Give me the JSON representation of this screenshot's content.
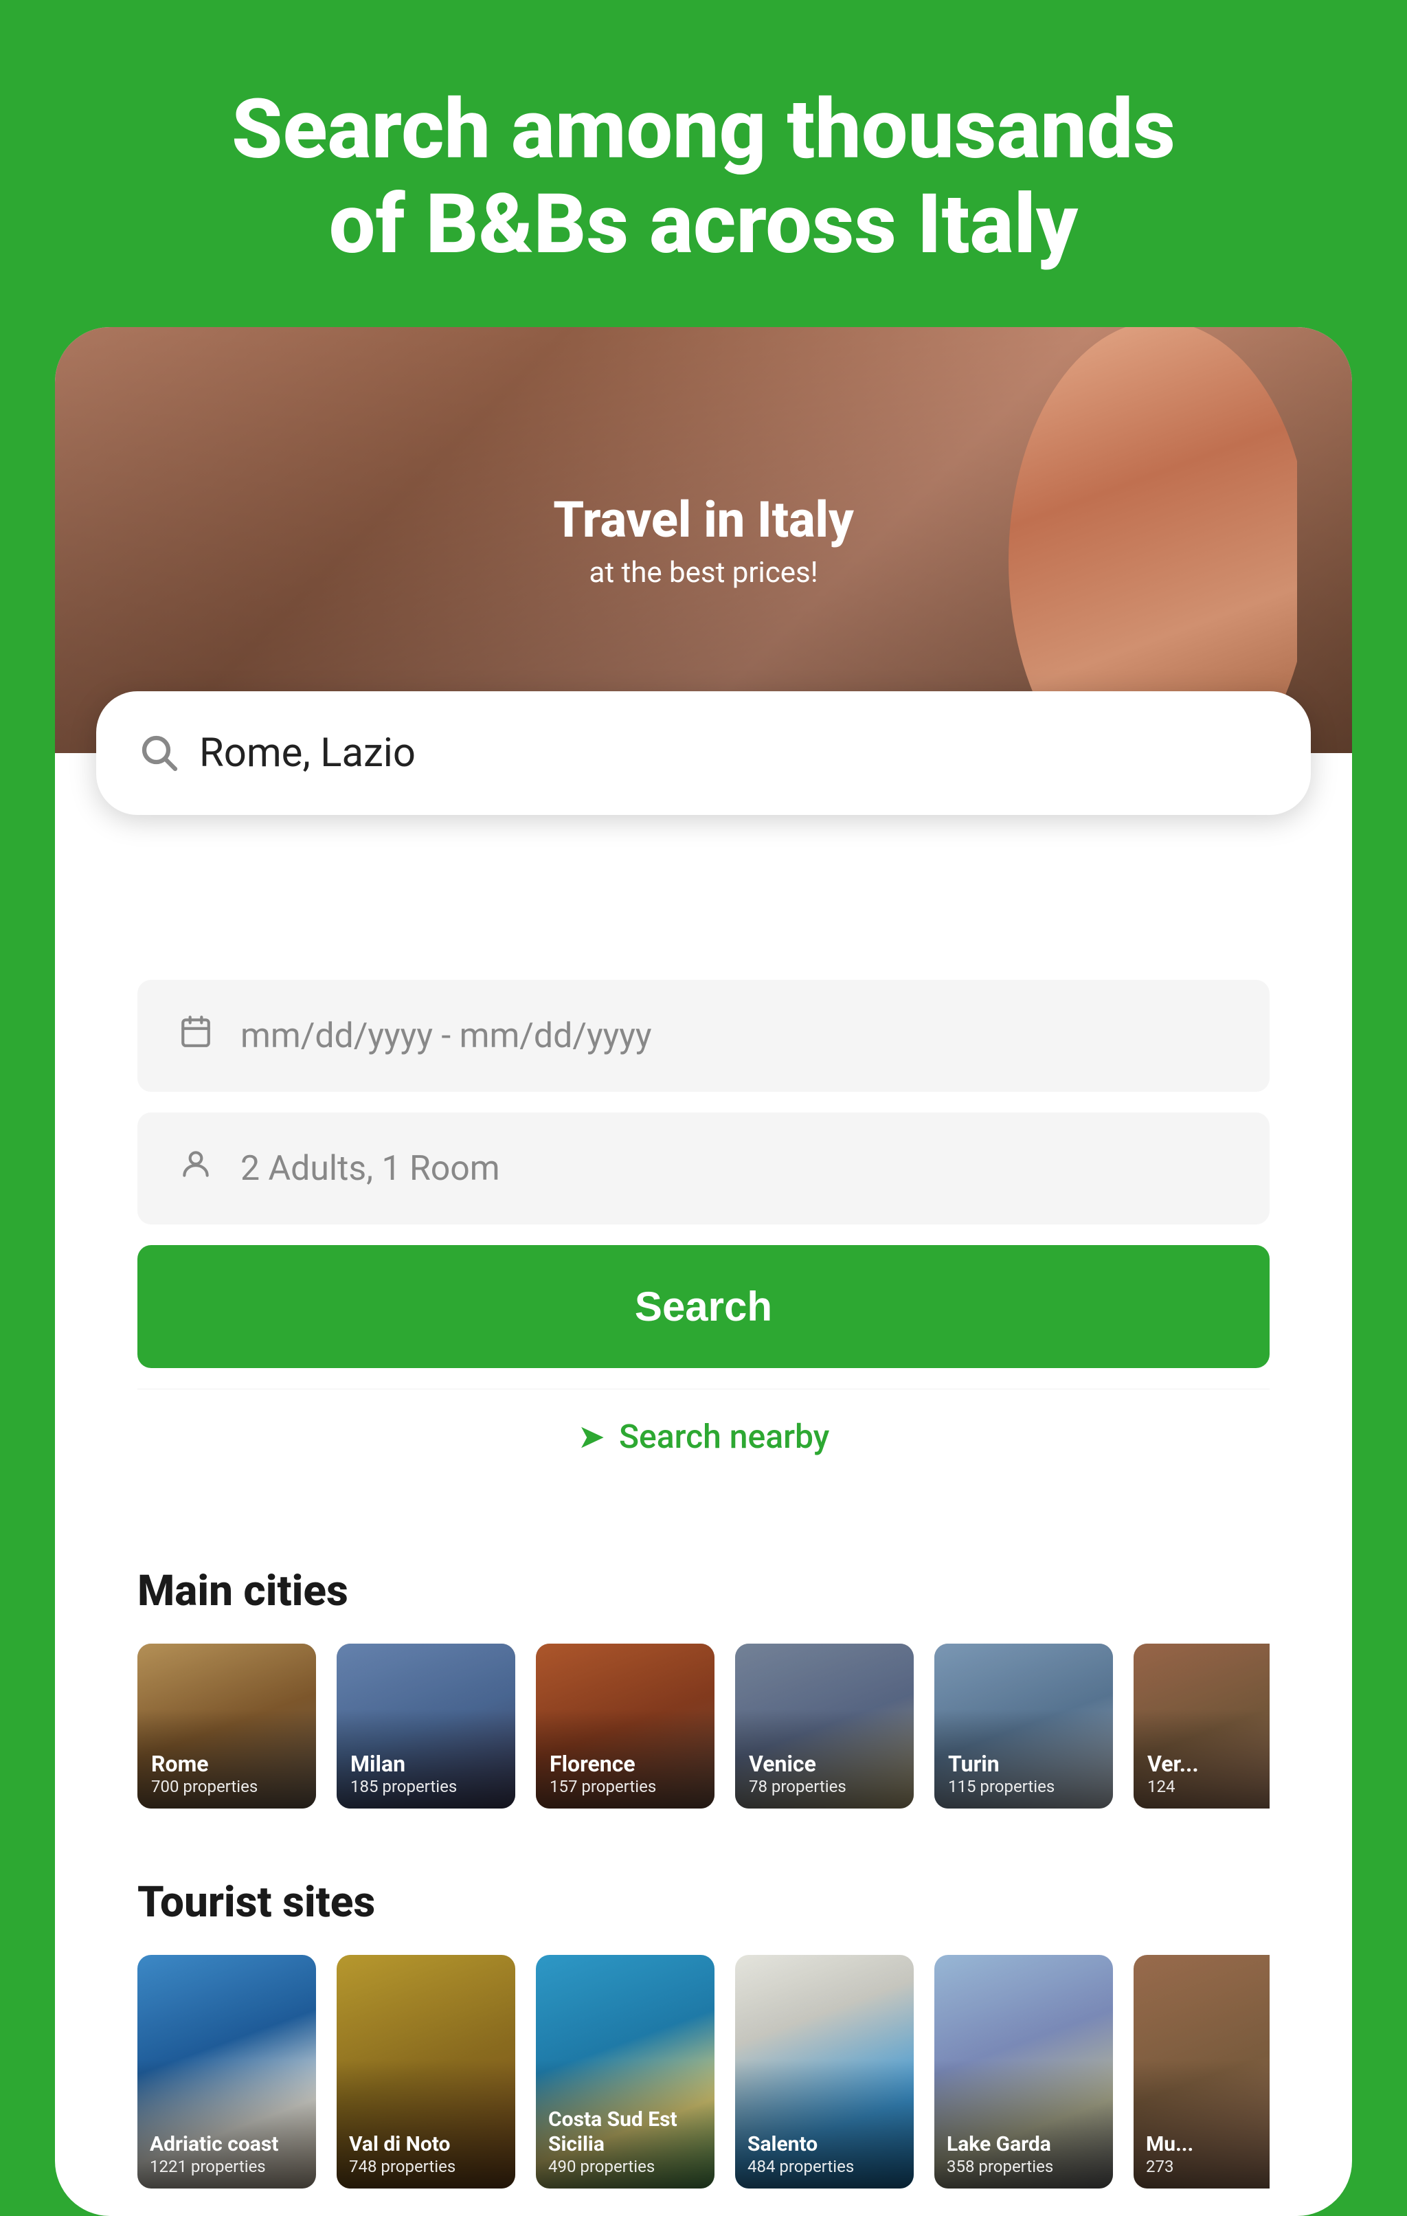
{
  "hero": {
    "main_title_line1": "Search among thousands",
    "main_title_line2": "of B&Bs across Italy",
    "travel_title": "Travel in Italy",
    "travel_subtitle": "at the best prices!"
  },
  "search": {
    "placeholder": "Rome, Lazio",
    "date_placeholder": "mm/dd/yyyy - mm/dd/yyyy",
    "guests_placeholder": "2 Adults, 1 Room",
    "button_label": "Search",
    "nearby_label": "Search nearby"
  },
  "main_cities": {
    "section_title": "Main cities",
    "items": [
      {
        "name": "Rome",
        "properties": "700 properties"
      },
      {
        "name": "Milan",
        "properties": "185 properties"
      },
      {
        "name": "Florence",
        "properties": "157 properties"
      },
      {
        "name": "Venice",
        "properties": "78 properties"
      },
      {
        "name": "Turin",
        "properties": "115 properties"
      },
      {
        "name": "Ver...",
        "properties": "124"
      }
    ]
  },
  "tourist_sites": {
    "section_title": "Tourist sites",
    "items": [
      {
        "name": "Adriatic coast",
        "properties": "1221 properties"
      },
      {
        "name": "Val di Noto",
        "properties": "748 properties"
      },
      {
        "name": "Costa Sud Est Sicilia",
        "properties": "490 properties"
      },
      {
        "name": "Salento",
        "properties": "484 properties"
      },
      {
        "name": "Lake Garda",
        "properties": "358 properties"
      },
      {
        "name": "Mu...",
        "properties": "273"
      }
    ]
  },
  "icons": {
    "search": "🔍",
    "calendar": "📅",
    "person": "👤",
    "navigation": "➤"
  }
}
